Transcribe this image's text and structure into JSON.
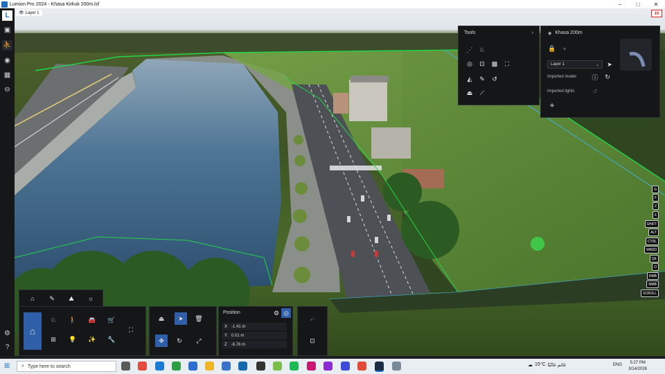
{
  "window": {
    "title": "Lumion Pro 2024 - Khasa Kirkuk 200m.lsf"
  },
  "viewport": {
    "layer_chip": "Layer 1",
    "error_count": "10"
  },
  "tools_panel": {
    "title": "Tools"
  },
  "model_panel": {
    "name": "Khasa 200m",
    "layer_select": "Layer 1",
    "imported_model_label": "Imported model",
    "imported_lights_label": "Imported lights",
    "add_symbol": "+"
  },
  "shortcut_keys": [
    "G",
    "F",
    "Z",
    "X",
    "SHIFT",
    "ALT",
    "CTRL",
    "WASD",
    "QE",
    "O",
    "RMB",
    "MMB",
    "SCROLL"
  ],
  "position_panel": {
    "title": "Position",
    "x_label": "X",
    "x_value": "-1.41 m",
    "y_label": "Y",
    "y_value": "0.01 m",
    "z_label": "Z",
    "z_value": "-6.76 m"
  },
  "taskbar": {
    "search_placeholder": "Type here to search",
    "weather": "15°C",
    "weather_text": "غائم غالبًا",
    "language": "ENG",
    "time": "5:27 PM",
    "date": "3/14/2026"
  },
  "colors": {
    "accent": "#2f5fa8",
    "outline": "#22d64a",
    "boundary": "#3fb0d6"
  }
}
